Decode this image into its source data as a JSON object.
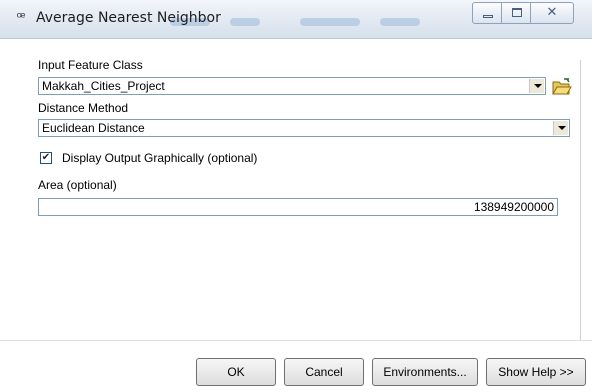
{
  "window": {
    "title": "Average Nearest Neighbor",
    "app_icon": "geoprocessing-tool-icon",
    "minimize_icon": "minimize-icon",
    "maximize_icon": "maximize-icon",
    "close_icon": "close-icon",
    "close_glyph": "✕"
  },
  "form": {
    "input_feature_class": {
      "label": "Input Feature Class",
      "value": "Makkah_Cities_Project",
      "browse_icon": "open-folder-icon"
    },
    "distance_method": {
      "label": "Distance Method",
      "value": "Euclidean Distance"
    },
    "display_output": {
      "label": "Display Output Graphically (optional)",
      "checked": true,
      "check_glyph": "✔"
    },
    "area": {
      "label": "Area (optional)",
      "value": "138949200000"
    }
  },
  "buttons": {
    "ok": "OK",
    "cancel": "Cancel",
    "environments": "Environments...",
    "show_help": "Show Help >>"
  },
  "colors": {
    "field_border": "#7f9db9",
    "titlebar": "#dfe7f1"
  }
}
